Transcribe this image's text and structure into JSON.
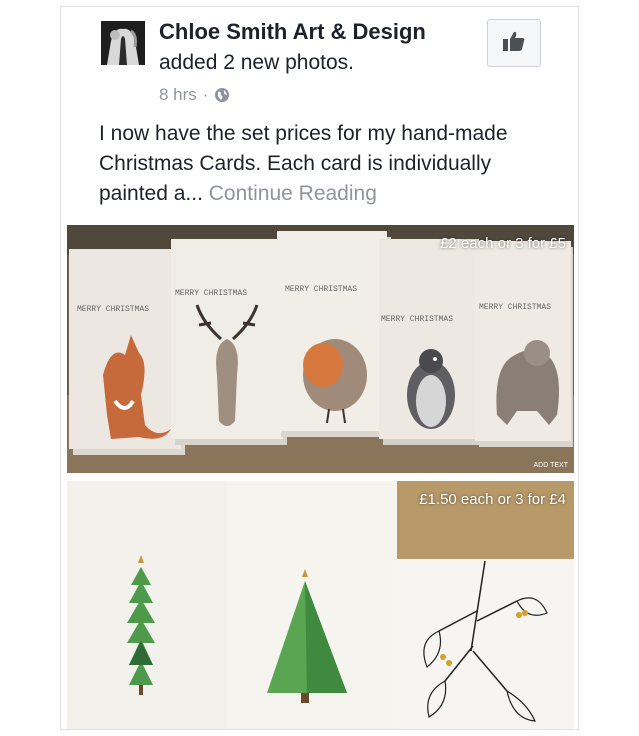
{
  "post": {
    "page_name": "Chloe Smith Art & Design",
    "action": "added 2 new photos.",
    "time": "8 hrs",
    "separator": "·",
    "audience_icon": "globe-icon",
    "text": "I now have the set prices for my hand-made Christmas Cards. Each card is individually painted a...",
    "continue_label": "Continue Reading",
    "like_icon": "thumbs-up-icon"
  },
  "photos": [
    {
      "price_text": "£2 each or 3 for £5",
      "card_caption": "MERRY CHRISTMAS",
      "subjects": [
        "fox",
        "stag",
        "robin",
        "penguin",
        "polar bear"
      ],
      "sticker": "ADD TEXT"
    },
    {
      "price_text": "£1.50 each or 3 for £4",
      "subjects": [
        "stacked christmas tree",
        "triangle christmas tree",
        "mistletoe"
      ]
    }
  ],
  "colors": {
    "text": "#1d2129",
    "muted": "#90949c",
    "border": "#dfe1e5",
    "card_green": "#5ea35a"
  }
}
